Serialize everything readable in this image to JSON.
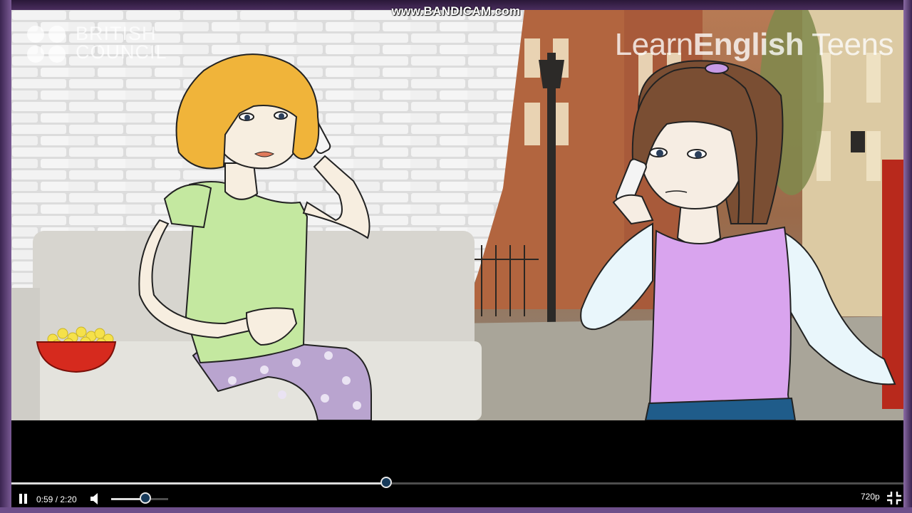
{
  "watermark": "www.BANDICAM.com",
  "logos": {
    "british_council": "BRITISH\nCOUNCIL",
    "learn_english_teens": {
      "prefix": "Learn",
      "bold": "English",
      "suffix": " Teens"
    }
  },
  "player": {
    "time": "0:59 / 2:20",
    "quality": "720p",
    "progress": 0.42,
    "volume": 0.6
  },
  "colors": {
    "brick": "#e9e9e9",
    "sofa": "#d9d8d2",
    "girl1_hair": "#f0b43a",
    "girl1_top": "#c4e8a0",
    "girl1_pants": "#b9a4cf",
    "girl2_hair": "#7a4e33",
    "girl2_top": "#d9a4ee",
    "girl2_sleeves": "#e9f6fb",
    "popcorn_bowl": "#d62a1e",
    "popcorn": "#f5e14a",
    "accent_thumb": "#173a5a"
  }
}
